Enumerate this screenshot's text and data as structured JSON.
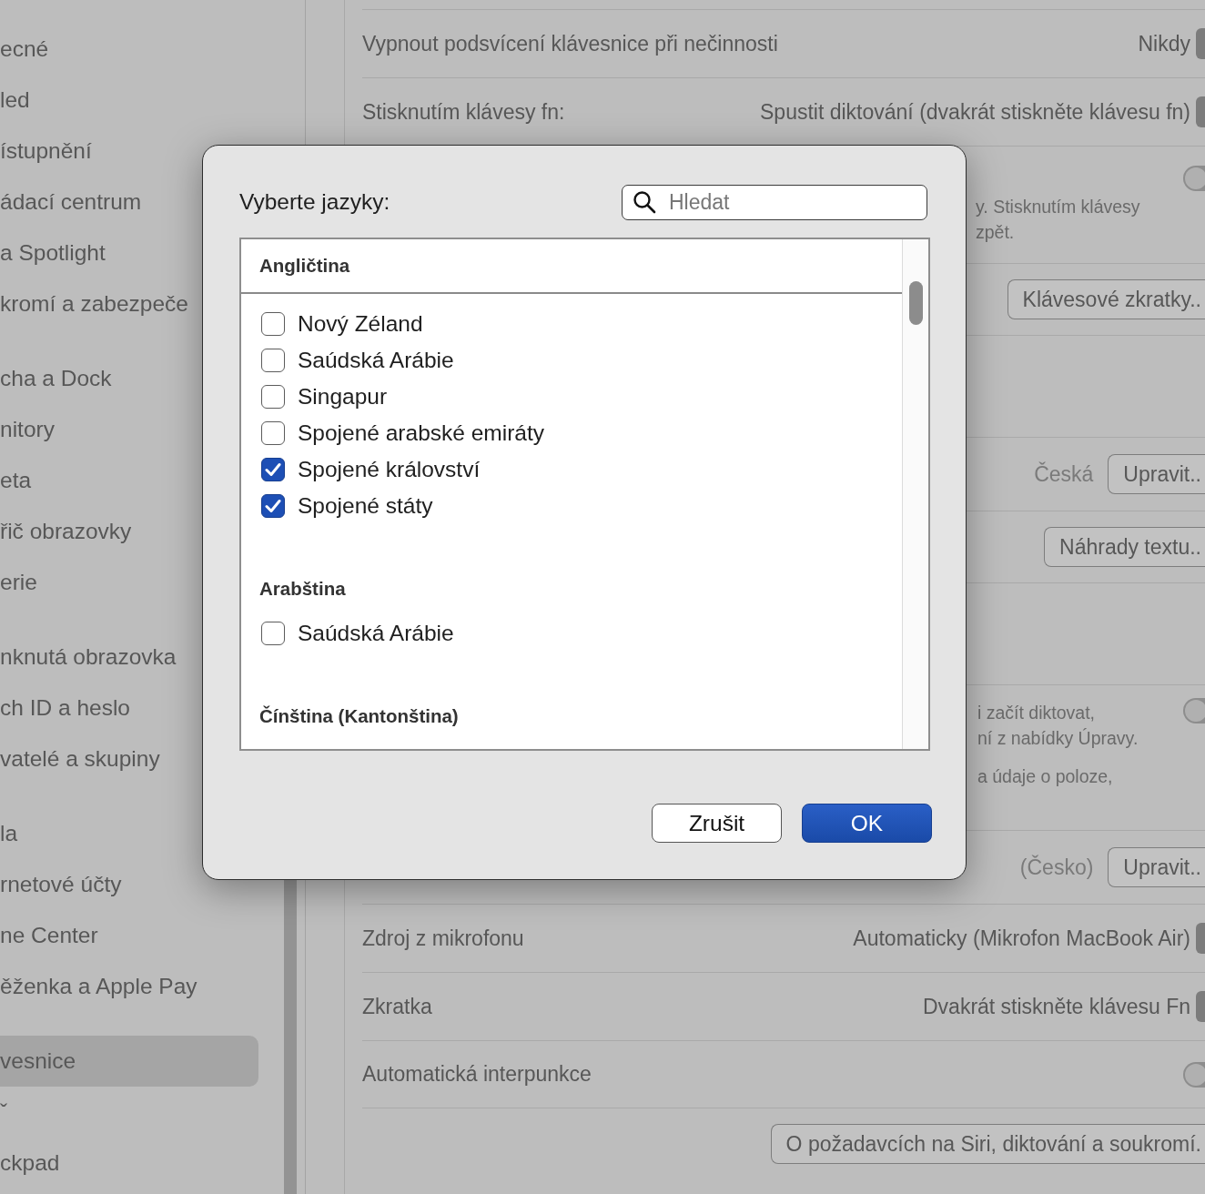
{
  "sidebar": {
    "groups": [
      {
        "items": [
          {
            "label": "ecné",
            "selected": false
          },
          {
            "label": "led",
            "selected": false
          },
          {
            "label": "ístupnění",
            "selected": false
          },
          {
            "label": "ádací centrum",
            "selected": false
          },
          {
            "label": "a Spotlight",
            "selected": false
          },
          {
            "label": "kromí a zabezpeče",
            "selected": false
          }
        ]
      },
      {
        "items": [
          {
            "label": "cha a Dock",
            "selected": false
          },
          {
            "label": "nitory",
            "selected": false
          },
          {
            "label": "eta",
            "selected": false
          },
          {
            "label": "řič obrazovky",
            "selected": false
          },
          {
            "label": "erie",
            "selected": false
          }
        ]
      },
      {
        "items": [
          {
            "label": "nknutá obrazovka",
            "selected": false
          },
          {
            "label": "ch ID a heslo",
            "selected": false
          },
          {
            "label": "vatelé a skupiny",
            "selected": false
          }
        ]
      },
      {
        "items": [
          {
            "label": "la",
            "selected": false
          },
          {
            "label": "rnetové účty",
            "selected": false
          },
          {
            "label": "ne Center",
            "selected": false
          },
          {
            "label": "ěženka a Apple Pay",
            "selected": false
          }
        ]
      },
      {
        "items": [
          {
            "label": "vesnice",
            "selected": true
          },
          {
            "label": "ˇ",
            "selected": false
          },
          {
            "label": "ckpad",
            "selected": false
          }
        ]
      }
    ]
  },
  "panel": {
    "rows": [
      {
        "kind": "popup",
        "label": "Vypnout podsvícení klávesnice při nečinnosti",
        "value": "Nikdy"
      },
      {
        "kind": "popup",
        "label": "Stisknutím klávesy fn:",
        "value": "Spustit diktování (dvakrát stiskněte klávesu fn)"
      },
      {
        "kind": "toggle_desc",
        "on": false,
        "notes": [
          [
            "y. Stisknutím klávesy",
            "zpět."
          ]
        ]
      },
      {
        "kind": "button",
        "button": "Klávesové zkratky.."
      },
      {
        "kind": "covered"
      },
      {
        "kind": "value_button",
        "value": "Česká",
        "button": "Upravit.."
      },
      {
        "kind": "button",
        "button": "Náhrady textu.."
      },
      {
        "kind": "covered"
      },
      {
        "kind": "toggle_note",
        "on": false,
        "notes": [
          [
            "i začít diktovat,",
            "ní z nabídky Úpravy."
          ],
          [
            "a údaje o poloze,"
          ]
        ]
      },
      {
        "kind": "value_button",
        "value": "(Česko)",
        "button": "Upravit.."
      },
      {
        "kind": "popup",
        "label": "Zdroj z mikrofonu",
        "value": "Automaticky (Mikrofon MacBook Air)"
      },
      {
        "kind": "popup",
        "label": "Zkratka",
        "value": "Dvakrát stiskněte klávesu Fn"
      },
      {
        "kind": "toggle",
        "label": "Automatická interpunkce",
        "on": false
      },
      {
        "kind": "button",
        "button": "O požadavcích na Siri, diktování a soukromí."
      }
    ]
  },
  "dialog": {
    "title": "Vyberte jazyky:",
    "search": {
      "placeholder": "Hledat"
    },
    "groups": [
      {
        "name": "Angličtina",
        "items": [
          {
            "label": "Nový Zéland",
            "checked": false
          },
          {
            "label": "Saúdská Arábie",
            "checked": false
          },
          {
            "label": "Singapur",
            "checked": false
          },
          {
            "label": "Spojené arabské emiráty",
            "checked": false
          },
          {
            "label": "Spojené království",
            "checked": true
          },
          {
            "label": "Spojené státy",
            "checked": true
          }
        ]
      },
      {
        "name": "Arabština",
        "items": [
          {
            "label": "Saúdská Arábie",
            "checked": false
          }
        ]
      },
      {
        "name": "Čínština (Kantonština)"
      }
    ],
    "buttons": [
      {
        "label": "Zrušit",
        "kind": "cancel"
      },
      {
        "label": "OK",
        "kind": "default"
      }
    ]
  }
}
